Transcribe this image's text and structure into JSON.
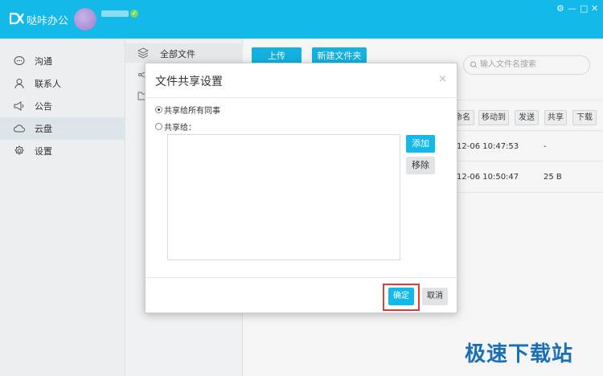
{
  "app": {
    "title": "哒咔办公",
    "logo_text": "DX",
    "window_controls": [
      "⚙",
      "—",
      "□",
      "✕"
    ]
  },
  "nav": {
    "items": [
      {
        "label": "沟通",
        "icon": "chat-icon"
      },
      {
        "label": "联系人",
        "icon": "person-icon"
      },
      {
        "label": "公告",
        "icon": "megaphone-icon"
      },
      {
        "label": "云盘",
        "icon": "cloud-icon",
        "active": true
      },
      {
        "label": "设置",
        "icon": "gear-icon"
      }
    ]
  },
  "subnav": {
    "items": [
      {
        "label": "全部文件",
        "icon": "layers-icon"
      }
    ]
  },
  "toolbar": {
    "upload": "上传",
    "new_folder": "新建文件夹",
    "search_placeholder": "输入文件名搜索",
    "actions": [
      "命名",
      "移动到",
      "发送",
      "共享",
      "下载"
    ]
  },
  "files": {
    "rows": [
      {
        "time": "12-06 10:47:53",
        "size": "-"
      },
      {
        "time": "12-06 10:50:47",
        "size": "25 B"
      }
    ]
  },
  "dialog": {
    "title": "文件共享设置",
    "close": "×",
    "option_all": "共享给所有同事",
    "option_some": "共享给：",
    "add": "添加",
    "remove": "移除",
    "ok": "确定",
    "cancel": "取消"
  },
  "watermark": "极速下载站",
  "colors": {
    "accent": "#13b9e9",
    "highlight": "#e53935"
  }
}
